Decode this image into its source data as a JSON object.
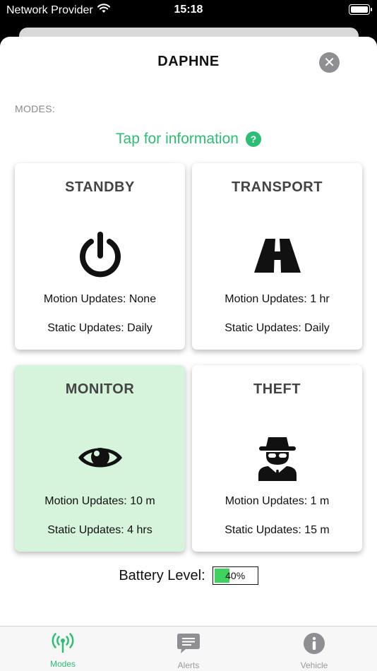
{
  "status_bar": {
    "carrier": "Network Provider",
    "time": "15:18"
  },
  "sheet": {
    "title": "DAPHNE",
    "section_label": "MODES:",
    "info_link": "Tap for information",
    "help_glyph": "?",
    "close_glyph": "✕"
  },
  "modes": [
    {
      "title": "STANDBY",
      "icon": "power-icon",
      "motion": "Motion Updates: None",
      "static": "Static Updates: Daily",
      "active": false
    },
    {
      "title": "TRANSPORT",
      "icon": "road-icon",
      "motion": "Motion Updates: 1 hr",
      "static": "Static Updates: Daily",
      "active": false
    },
    {
      "title": "MONITOR",
      "icon": "eye-icon",
      "motion": "Motion Updates: 10 m",
      "static": "Static Updates: 4 hrs",
      "active": true
    },
    {
      "title": "THEFT",
      "icon": "spy-icon",
      "motion": "Motion Updates: 1 m",
      "static": "Static Updates: 15 m",
      "active": false
    }
  ],
  "battery": {
    "label": "Battery Level:",
    "percent": 40,
    "text": "40%",
    "fill_color": "#3fd25e"
  },
  "tabs": [
    {
      "label": "Modes",
      "icon": "antenna-icon",
      "active": true
    },
    {
      "label": "Alerts",
      "icon": "message-icon",
      "active": false
    },
    {
      "label": "Vehicle",
      "icon": "info-icon",
      "active": false
    }
  ],
  "colors": {
    "accent": "#2dbd74",
    "active_card": "#d6f3dc",
    "tab_inactive": "#999999"
  }
}
